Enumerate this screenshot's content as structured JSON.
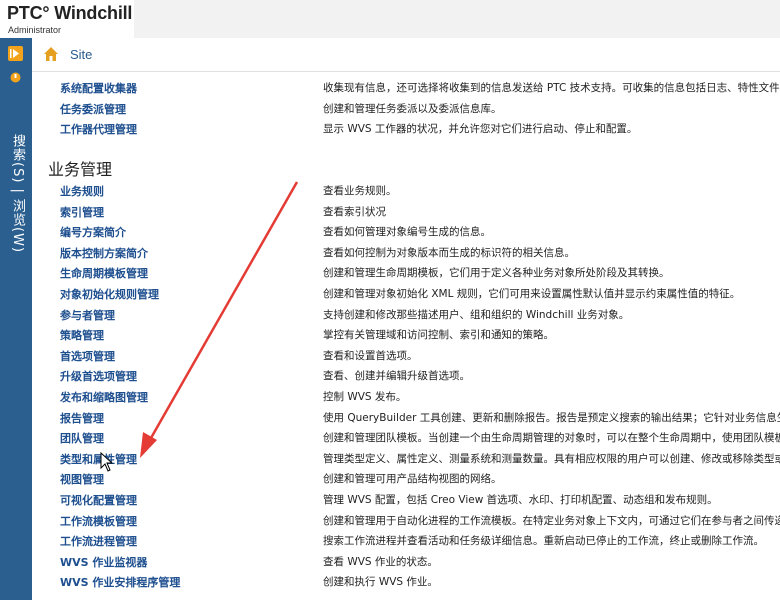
{
  "app": {
    "title": "PTC° Windchill",
    "subtitle": "Administrator"
  },
  "leftbar": {
    "vertical_label": "搜索(S) | 浏览(W)"
  },
  "breadcrumb": {
    "site": "Site"
  },
  "colors": {
    "link": "#1e4f8f",
    "leftbar": "#2b5f8f",
    "arrow": "#e43b35"
  },
  "top_rows": [
    {
      "name": "系统配置收集器",
      "desc": "收集现有信息，还可选择将收集到的信息发送给 PTC 技术支持。可收集的信息包括日志、特性文件、XC"
    },
    {
      "name": "任务委派管理",
      "desc": "创建和管理任务委派以及委派信息库。"
    },
    {
      "name": "工作器代理管理",
      "desc": "显示 WVS 工作器的状况，并允许您对它们进行启动、停止和配置。"
    }
  ],
  "section": {
    "title": "业务管理"
  },
  "business_rows": [
    {
      "name": "业务规则",
      "desc": "查看业务规则。"
    },
    {
      "name": "索引管理",
      "desc": "查看索引状况"
    },
    {
      "name": "编号方案简介",
      "desc": "查看如何管理对象编号生成的信息。"
    },
    {
      "name": "版本控制方案简介",
      "desc": "查看如何控制为对象版本而生成的标识符的相关信息。"
    },
    {
      "name": "生命周期模板管理",
      "desc": "创建和管理生命周期模板，它们用于定义各种业务对象所处阶段及其转换。"
    },
    {
      "name": "对象初始化规则管理",
      "desc": "创建和管理对象初始化 XML 规则，它们可用来设置属性默认值并显示约束属性值的特征。"
    },
    {
      "name": "参与者管理",
      "desc": "支持创建和修改那些描述用户、组和组织的 Windchill 业务对象。"
    },
    {
      "name": "策略管理",
      "desc": "掌控有关管理域和访问控制、索引和通知的策略。"
    },
    {
      "name": "首选项管理",
      "desc": "查看和设置首选项。"
    },
    {
      "name": "升级首选项管理",
      "desc": "查看、创建并编辑升级首选项。"
    },
    {
      "name": "发布和缩略图管理",
      "desc": "控制 WVS 发布。"
    },
    {
      "name": "报告管理",
      "desc": "使用 QueryBuilder 工具创建、更新和删除报告。报告是预定义搜索的输出结果；它针对业务信息生成统计"
    },
    {
      "name": "团队管理",
      "desc": "创建和管理团队模板。当创建一个由生命周期管理的对象时，可以在整个生命周期中，使用团队模板作为"
    },
    {
      "name": "类型和属性管理",
      "desc": "管理类型定义、属性定义、测量系统和测量数量。具有相应权限的用户可以创建、修改或移除类型或属性"
    },
    {
      "name": "视图管理",
      "desc": "创建和管理可用产品结构视图的网络。"
    },
    {
      "name": "可视化配置管理",
      "desc": "管理 WVS 配置，包括 Creo View 首选项、水印、打印机配置、动态组和发布规则。"
    },
    {
      "name": "工作流模板管理",
      "desc": "创建和管理用于自动化进程的工作流模板。在特定业务对象上下文内，可通过它们在参与者之间传递信息"
    },
    {
      "name": "工作流进程管理",
      "desc": "搜索工作流进程并查看活动和任务级详细信息。重新启动已停止的工作流，终止或删除工作流。"
    },
    {
      "name": "WVS 作业监视器",
      "desc": "查看 WVS 作业的状态。"
    },
    {
      "name": "WVS 作业安排程序管理",
      "desc": "创建和执行 WVS 作业。"
    }
  ]
}
